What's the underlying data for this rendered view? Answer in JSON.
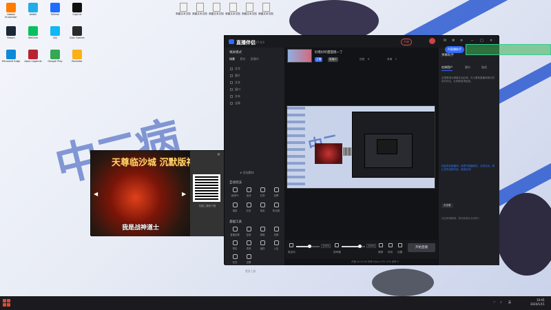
{
  "desktop": {
    "apps": [
      {
        "label": "Adobe Illustrator",
        "color": "#ff7c00"
      },
      {
        "label": "bilibili",
        "color": "#23ade5"
      },
      {
        "label": "ToDesk",
        "color": "#1f6bff"
      },
      {
        "label": "CapCut",
        "color": "#111111"
      },
      {
        "label": "Steam",
        "color": "#1b2838"
      },
      {
        "label": "WeChat",
        "color": "#07c160"
      },
      {
        "label": "QQ",
        "color": "#12b7f5"
      },
      {
        "label": "Epic Games",
        "color": "#2a2a2a"
      },
      {
        "label": "Microsoft Edge",
        "color": "#0c8ad8"
      },
      {
        "label": "Apex Legends",
        "color": "#b8232f"
      },
      {
        "label": "Google Play",
        "color": "#34a853"
      },
      {
        "label": "Rockstar",
        "color": "#fcaf17"
      }
    ],
    "files": [
      "新建文本文档",
      "新建文本文档",
      "新建文本文档",
      "新建文本文档",
      "新建文本文档",
      "新建文本文档"
    ]
  },
  "ad": {
    "title": "天尊临沙城 沉默版神装",
    "subtitle": "我是战神道士",
    "qr_caption": "扫描二维码下载",
    "close": "×"
  },
  "app": {
    "title": "直播伴侣",
    "version": "V7.8.6",
    "upgrade": "升级",
    "left": {
      "mode": "横屏模式",
      "tabs": [
        "场景",
        "素材",
        "直播间"
      ],
      "sources": [
        "文字",
        "图片",
        "文本",
        "窗口",
        "文本",
        "全屏"
      ],
      "add_source": "添加素材",
      "interact_title": "互动玩法",
      "interact_tools": [
        "连线PK",
        "连线",
        "礼物",
        "投票",
        "福袋",
        "红包",
        "抽奖",
        "粉丝团"
      ],
      "basic_title": "基础工具",
      "basic_tools": [
        "直播设置",
        "复制",
        "弹幕",
        "录屏",
        "预告",
        "表情",
        "道具",
        "公告",
        "任务",
        "设置"
      ],
      "more_tools": "更多工具"
    },
    "center": {
      "room_name": "好看好听甜甜唱一了",
      "pills": [
        {
          "label": "主播",
          "color": "#2f6bff"
        },
        {
          "label": "直播中",
          "color": "#444"
        }
      ],
      "stats": [
        "在线",
        "0",
        "本场",
        "0"
      ],
      "vol1": "100%",
      "vol2": "100%",
      "vol1_label": "麦克风",
      "vol2_label": "扬声器",
      "mic_level": 0.55,
      "spk_level": 0.75,
      "bb_icons": [
        "美颜",
        "特效",
        "设置"
      ],
      "go_live": "开始直播",
      "statusline": "开播 00:00:00  码率 0kb/s  CPU 12%  帧率 0"
    },
    "right": {
      "head": "弹幕助手",
      "tabs": [
        "在线用户",
        "观众",
        "私信"
      ],
      "note1": "这里是观众弹幕互动区域，可以看到直播间观众的实时评论、礼物和进场信息。",
      "welcome": "欢迎来到直播间，请遵守直播规范，文明互动，禁止发布违规内容。感谢支持！",
      "btn": "去查看",
      "foot": "还没有弹幕哦，快去和观众互动吧～"
    },
    "cloud_btn": "AI直播助手"
  },
  "taskbar": {
    "tray": "英",
    "time": "10:45",
    "date": "2024/1/15"
  }
}
